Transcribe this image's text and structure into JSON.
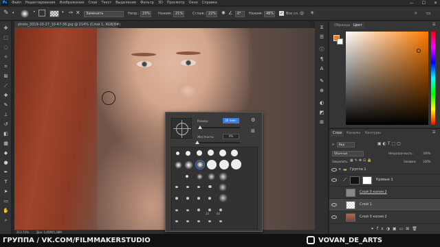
{
  "app": {
    "logo": "Ps"
  },
  "menu": [
    "Файл",
    "Редактирование",
    "Изображение",
    "Слои",
    "Текст",
    "Выделение",
    "Фильтр",
    "3D",
    "Просмотр",
    "Окно",
    "Справка"
  ],
  "window_controls": [
    "—",
    "☐",
    "✕"
  ],
  "options": {
    "mode_value": "Заменить",
    "opacity_label": "Непр.:",
    "opacity_value": "23%",
    "flow_label": "Нажим:",
    "flow_value": "21%",
    "smoothing_label": "Сглаж.:",
    "smoothing_value": "22%",
    "angle_value": "0°",
    "pressure_label": "Нажим:",
    "pressure_value": "48%",
    "all_layers_label": "Все сл."
  },
  "document": {
    "tab_title": "photo_2019-10-27_10-47-36.jpg @ 214% (Слой 1, RGB/8#)",
    "zoom": "213.72%",
    "doc_size": "Док: 1,45M/5,38M"
  },
  "brush_popup": {
    "size_label": "Размер:",
    "size_value": "20 пикс.",
    "hardness_label": "Жесткость:",
    "hardness_value": "0%",
    "size_fraction": 0.07,
    "hardness_fraction": 0.0,
    "tip_labels": [
      "20",
      "60"
    ]
  },
  "color_panel": {
    "tabs": [
      "Образцы",
      "Цвет"
    ],
    "active_tab": "Цвет",
    "foreground_color": "#f47d20",
    "background_color": "#ffffff"
  },
  "layers_panel": {
    "tabs": [
      "Слои",
      "Каналы",
      "Контуры"
    ],
    "filter_value": "Вид",
    "blend_mode": "Обычные",
    "opacity_label": "Непрозрачность:",
    "opacity_value": "100%",
    "lock_label": "Закрепить:",
    "fill_label": "Заливка:",
    "fill_value": "100%",
    "layers": [
      {
        "name": "Группа 1",
        "kind": "group"
      },
      {
        "name": "Кривые 1",
        "kind": "adjustment"
      },
      {
        "name": "Слой 0 копия 2",
        "kind": "gray"
      },
      {
        "name": "Слой 1",
        "kind": "transparent"
      },
      {
        "name": "Слой 0 копия 2",
        "kind": "photo"
      }
    ]
  },
  "watermark": {
    "left": "ГРУППА / VK.COM/FILMMAKERSTUDIO",
    "right": "VOVAN_DE_ARTS"
  }
}
